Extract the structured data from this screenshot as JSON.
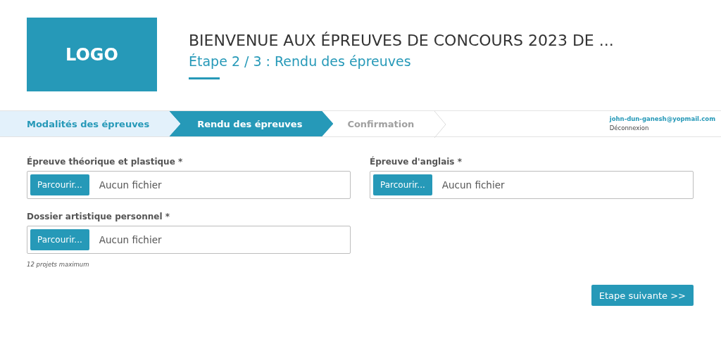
{
  "header": {
    "logo": "LOGO",
    "title": "BIENVENUE AUX ÉPREUVES DE CONCOURS 2023 DE ...",
    "subtitle": "Étape 2 / 3 : Rendu des épreuves"
  },
  "steps": [
    {
      "label": "Modalités des épreuves",
      "selected": false
    },
    {
      "label": "Rendu des épreuves",
      "selected": true
    },
    {
      "label": "Confirmation",
      "selected": false
    }
  ],
  "account": {
    "email": "john-dun-ganesh@yopmail.com",
    "logout": "Déconnexion"
  },
  "fields": [
    {
      "label": "Épreuve théorique et plastique *",
      "button": "Parcourir...",
      "value": "Aucun fichier"
    },
    {
      "label": "Épreuve d'anglais *",
      "button": "Parcourir...",
      "value": "Aucun fichier"
    },
    {
      "label": "Dossier artistique personnel *",
      "button": "Parcourir...",
      "value": "Aucun fichier",
      "hint": "12 projets maximum"
    }
  ],
  "next_button": "Etape suivante >>"
}
